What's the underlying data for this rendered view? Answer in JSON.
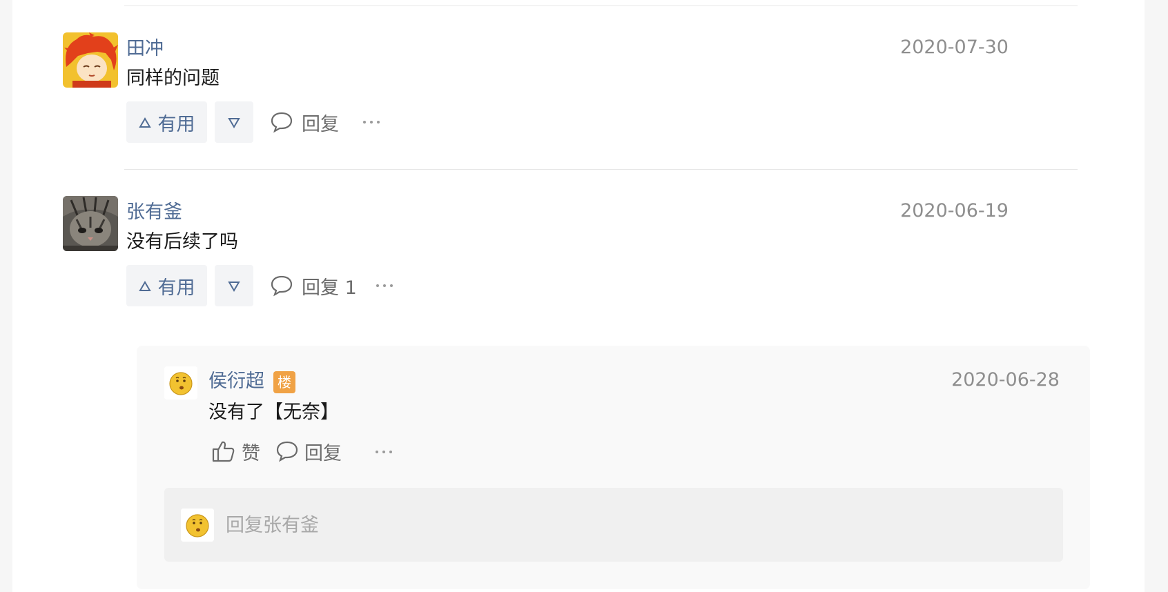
{
  "comments": [
    {
      "author": "田冲",
      "date": "2020-07-30",
      "content": "同样的问题",
      "upvote_label": "有用",
      "upvote_icon": "triangle-up-icon",
      "downvote_icon": "triangle-down-icon",
      "reply_label": "回复",
      "avatar_icon": "red-hair-cartoon-avatar"
    },
    {
      "author": "张有釜",
      "date": "2020-06-19",
      "content": "没有后续了吗",
      "upvote_label": "有用",
      "upvote_icon": "triangle-up-icon",
      "downvote_icon": "triangle-down-icon",
      "reply_label": "回复 1",
      "avatar_icon": "tabby-cat-avatar",
      "replies": [
        {
          "author": "侯衍超",
          "badge": "楼",
          "date": "2020-06-28",
          "content": "没有了【无奈】",
          "like_label": "赞",
          "reply_label": "回复",
          "avatar_icon": "emoji-face-avatar"
        }
      ],
      "reply_input": {
        "placeholder": "回复张有釜",
        "avatar_icon": "emoji-face-avatar"
      }
    }
  ],
  "colors": {
    "author": "#4f6b94",
    "date": "#8e8e8e",
    "badge": "#f0a245",
    "button_bg": "#f3f4f6"
  }
}
